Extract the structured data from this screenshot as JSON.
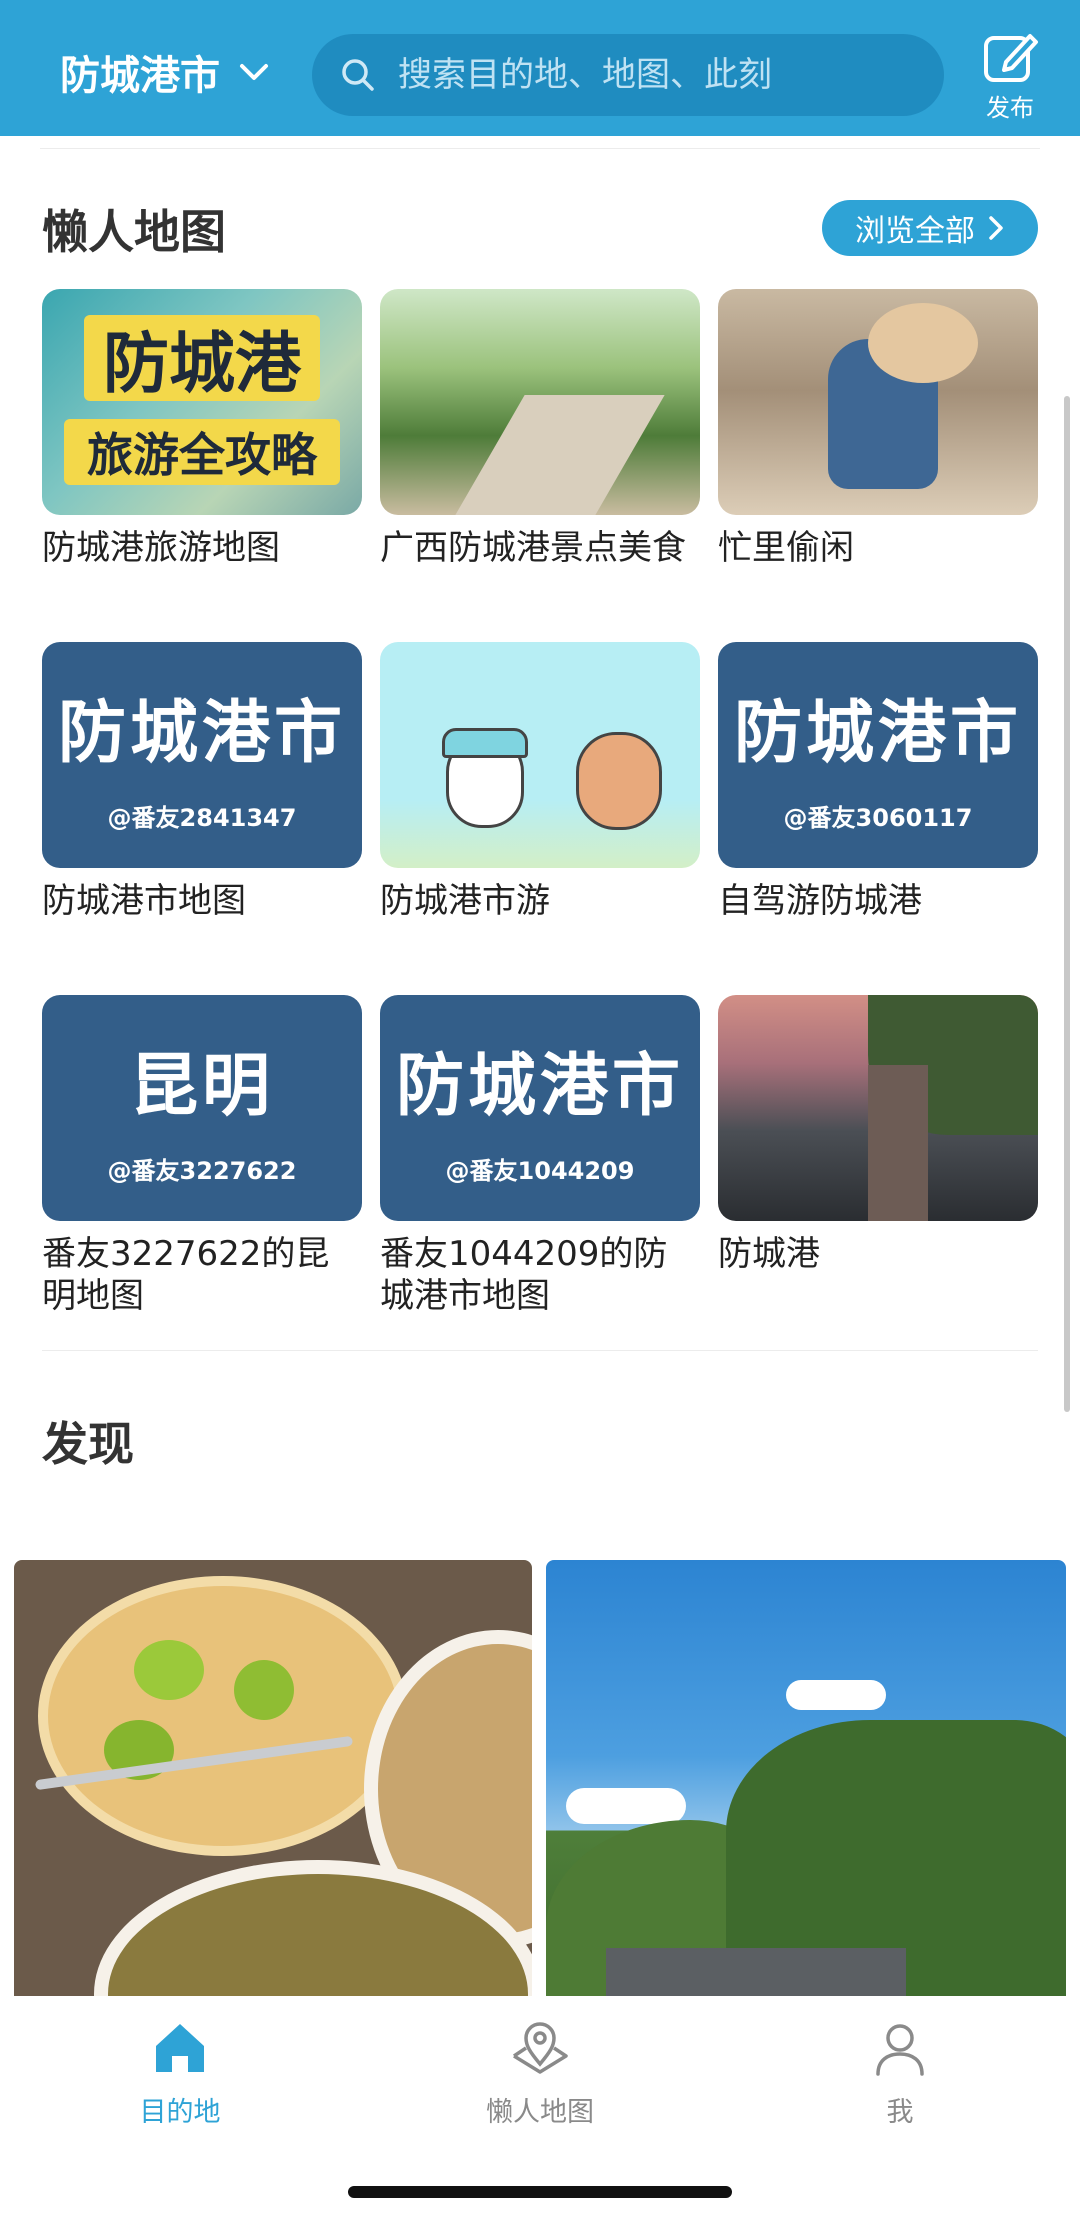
{
  "header": {
    "city": "防城港市",
    "search_placeholder": "搜索目的地、地图、此刻",
    "publish_label": "发布"
  },
  "lazy_maps": {
    "title": "懒人地图",
    "browse_all": "浏览全部",
    "items": [
      {
        "title": "防城港旅游地图",
        "thumb_line1": "防城港",
        "thumb_line2": "旅游全攻略"
      },
      {
        "title": "广西防城港景点美食"
      },
      {
        "title": "忙里偷闲"
      },
      {
        "title": "防城港市地图",
        "thumb_big": "防城港市",
        "thumb_small": "@番友2841347"
      },
      {
        "title": "防城港市游"
      },
      {
        "title": "自驾游防城港",
        "thumb_big": "防城港市",
        "thumb_small": "@番友3060117"
      },
      {
        "title": "番友3227622的昆明地图",
        "thumb_big": "昆明",
        "thumb_small": "@番友3227622"
      },
      {
        "title": "番友1044209的防城港市地图",
        "thumb_big": "防城港市",
        "thumb_small": "@番友1044209"
      },
      {
        "title": "防城港"
      }
    ]
  },
  "discover": {
    "title": "发现"
  },
  "bottom_nav": {
    "items": [
      {
        "label": "目的地",
        "active": true,
        "icon": "home-icon"
      },
      {
        "label": "懒人地图",
        "active": false,
        "icon": "map-pin-icon"
      },
      {
        "label": "我",
        "active": false,
        "icon": "user-icon"
      }
    ]
  },
  "colors": {
    "accent": "#2ea3d6",
    "card_blue": "#335e89",
    "inactive": "#8a8a8a"
  }
}
